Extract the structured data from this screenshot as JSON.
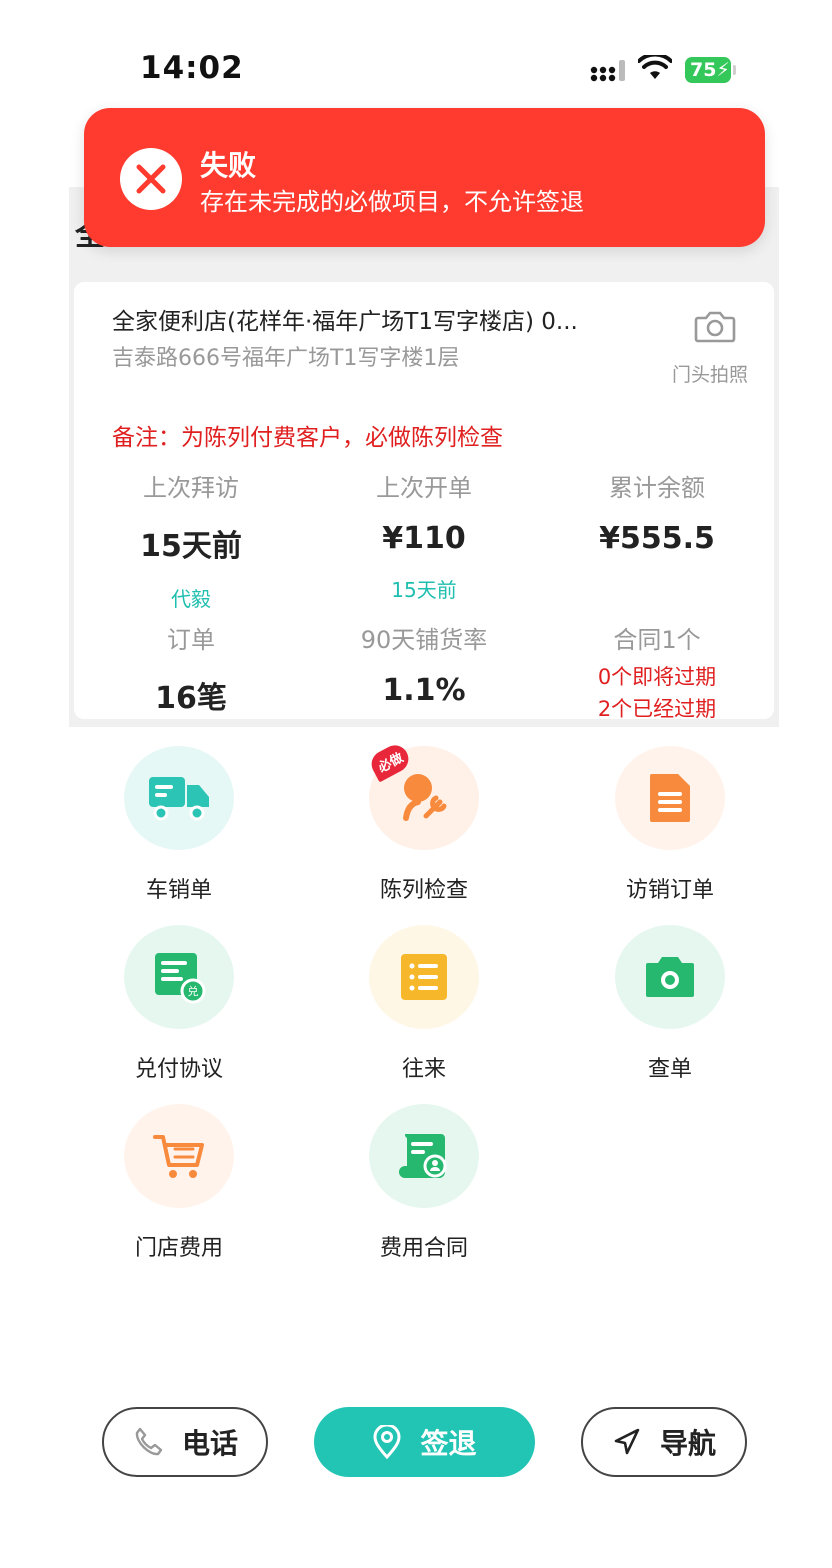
{
  "status_bar": {
    "time": "14:02",
    "battery": "75"
  },
  "page": {
    "hidden_title_fragment": "全"
  },
  "toast": {
    "title": "失败",
    "message": "存在未完成的必做项目，不允许签退"
  },
  "store": {
    "name": "全家便利店(花样年·福年广场T1写字楼店) 0...",
    "address": "吉泰路666号福年广场T1写字楼1层",
    "photo_label": "门头拍照",
    "remark": "备注：为陈列付费客户，必做陈列检查"
  },
  "stats": [
    {
      "label": "上次拜访",
      "value": "15天前",
      "sub": "代毅"
    },
    {
      "label": "上次开单",
      "value": "¥110",
      "sub": "15天前"
    },
    {
      "label": "累计余额",
      "value": "¥555.5"
    },
    {
      "label": "订单",
      "value": "16笔"
    },
    {
      "label": "90天铺货率",
      "value": "1.1%"
    },
    {
      "label": "合同1个",
      "lines": [
        "0个即将过期",
        "2个已经过期"
      ]
    }
  ],
  "actions": [
    {
      "label": "车销单",
      "icon": "truck-icon",
      "bg": "#e6f8f6",
      "color": "#2cc4b4"
    },
    {
      "label": "陈列检查",
      "icon": "display-check-icon",
      "bg": "#fff0e8",
      "color": "#f78a3c",
      "badge": "必做"
    },
    {
      "label": "访销订单",
      "icon": "document-icon",
      "bg": "#fff3ec",
      "color": "#f78a3c"
    },
    {
      "label": "兑付协议",
      "icon": "agreement-icon",
      "bg": "#e6f7f0",
      "color": "#26b86e"
    },
    {
      "label": "往来",
      "icon": "list-icon",
      "bg": "#fff7e6",
      "color": "#f6b82a"
    },
    {
      "label": "查单",
      "icon": "camera-icon",
      "bg": "#e6f7f0",
      "color": "#26b86e"
    },
    {
      "label": "门店费用",
      "icon": "cart-icon",
      "bg": "#fff3ec",
      "color": "#f78a3c"
    },
    {
      "label": "费用合同",
      "icon": "contract-icon",
      "bg": "#e6f7f0",
      "color": "#26b86e"
    }
  ],
  "buttons": {
    "call": "电话",
    "checkout": "签退",
    "navigate": "导航"
  }
}
